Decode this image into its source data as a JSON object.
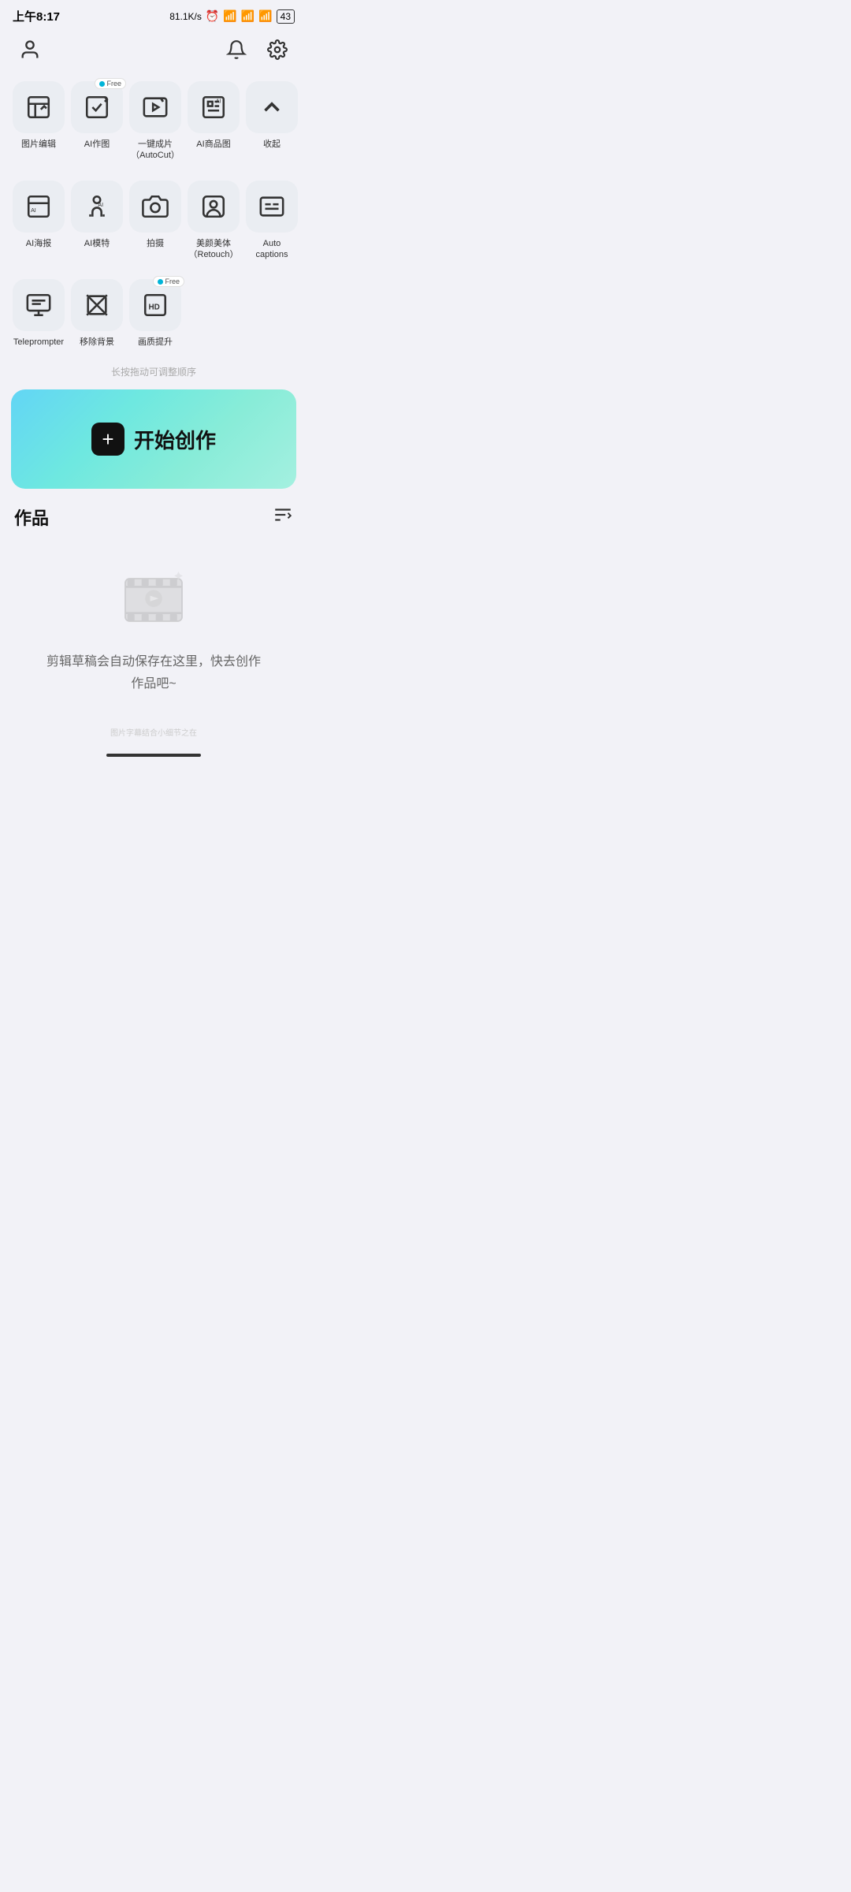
{
  "statusBar": {
    "time": "上午8:17",
    "speed": "81.1K/s",
    "battery": "43"
  },
  "nav": {
    "profileIcon": "person",
    "notificationIcon": "bell",
    "settingsIcon": "gear"
  },
  "toolGrid": {
    "rows": [
      [
        {
          "id": "image-edit",
          "label": "图片编辑",
          "icon": "image-edit",
          "badge": null
        },
        {
          "id": "ai-draw",
          "label": "AI作图",
          "icon": "ai-draw",
          "badge": "Free"
        },
        {
          "id": "autocut",
          "label": "一键成片\n（AutoCut）",
          "icon": "autocut",
          "badge": null
        },
        {
          "id": "ai-product",
          "label": "AI商品图",
          "icon": "ai-product",
          "badge": null
        },
        {
          "id": "collapse",
          "label": "收起",
          "icon": "chevron-up",
          "badge": null
        }
      ],
      [
        {
          "id": "ai-poster",
          "label": "AI海报",
          "icon": "ai-poster",
          "badge": null
        },
        {
          "id": "ai-model",
          "label": "AI模特",
          "icon": "ai-model",
          "badge": null
        },
        {
          "id": "camera",
          "label": "拍摄",
          "icon": "camera",
          "badge": null
        },
        {
          "id": "retouch",
          "label": "美颜美体\n（Retouch）",
          "icon": "retouch",
          "badge": null
        },
        {
          "id": "captions",
          "label": "Auto captions",
          "icon": "captions",
          "badge": null
        }
      ],
      [
        {
          "id": "teleprompter",
          "label": "Teleprompter",
          "icon": "teleprompter",
          "badge": null
        },
        {
          "id": "remove-bg",
          "label": "移除背景",
          "icon": "remove-bg",
          "badge": null
        },
        {
          "id": "enhance",
          "label": "画质提升",
          "icon": "enhance",
          "badge": "Free"
        }
      ]
    ]
  },
  "hintText": "长按拖动可调整顺序",
  "startButton": {
    "plusLabel": "+",
    "text": "开始创作"
  },
  "worksSection": {
    "title": "作品",
    "emptyText": "剪辑草稿会自动保存在这里，快去创作\n作品吧~"
  },
  "watermark": "图片字幕结合小细节之在"
}
